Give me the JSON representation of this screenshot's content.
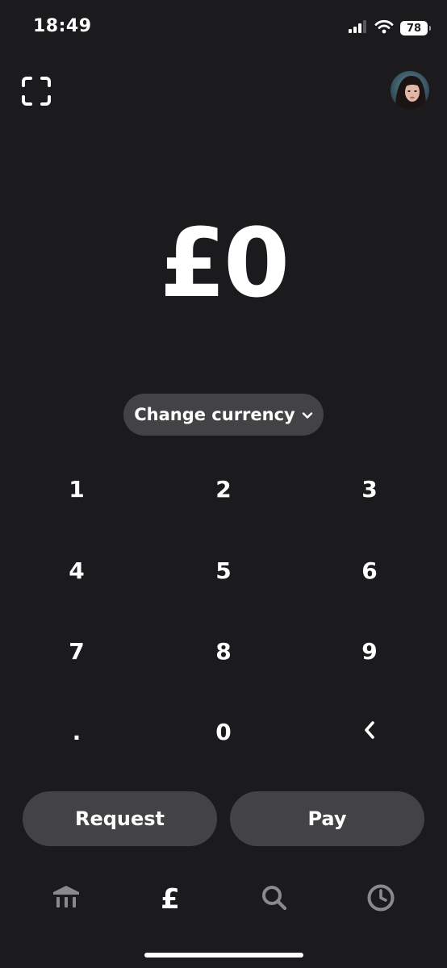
{
  "status_bar": {
    "time": "18:49",
    "battery": "78",
    "signal_icon": "signal-bars-icon",
    "wifi_icon": "wifi-icon"
  },
  "header": {
    "scan_icon": "qr-scan-icon",
    "avatar": "profile-avatar"
  },
  "amount": {
    "display": "£0"
  },
  "currency": {
    "label": "Change currency",
    "icon": "chevron-down-icon"
  },
  "keypad": {
    "keys": [
      "1",
      "2",
      "3",
      "4",
      "5",
      "6",
      "7",
      "8",
      "9",
      ".",
      "0"
    ],
    "backspace_icon": "chevron-left-icon"
  },
  "actions": {
    "request_label": "Request",
    "pay_label": "Pay"
  },
  "tab_bar": {
    "tabs": [
      {
        "icon": "bank-icon",
        "active": false
      },
      {
        "icon": "pound-icon",
        "label": "£",
        "active": true
      },
      {
        "icon": "search-icon",
        "active": false
      },
      {
        "icon": "clock-icon",
        "active": false
      }
    ]
  },
  "colors": {
    "background": "#1b1b1d",
    "pill": "#434345",
    "text": "#ffffff",
    "inactive_icon": "#8a8a8c"
  }
}
